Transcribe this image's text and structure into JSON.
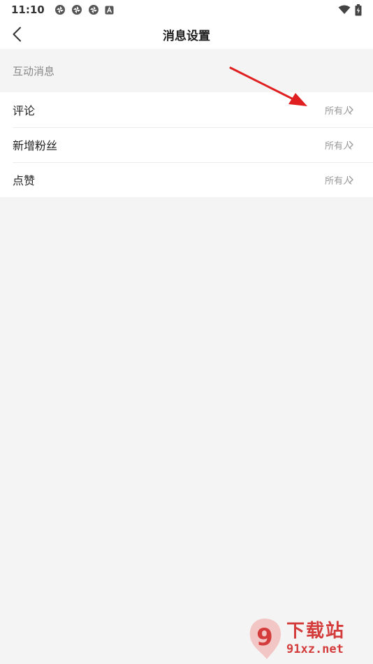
{
  "status_bar": {
    "time": "11:10",
    "left_icons": [
      "aperture-icon",
      "aperture-icon",
      "aperture-icon",
      "a-badge-icon"
    ],
    "right_icons": [
      "wifi-icon",
      "battery-charging-icon"
    ]
  },
  "nav": {
    "title": "消息设置",
    "back_icon": "chevron-left-icon"
  },
  "section": {
    "title": "互动消息"
  },
  "items": [
    {
      "label": "评论",
      "value": "所有人"
    },
    {
      "label": "新增粉丝",
      "value": "所有人"
    },
    {
      "label": "点赞",
      "value": "所有人"
    }
  ],
  "annotation": {
    "color": "#e02020"
  },
  "watermark": {
    "logo_text": "9",
    "text_cn": "下载站",
    "url": "91xz.net",
    "color": "#d43b3b"
  }
}
